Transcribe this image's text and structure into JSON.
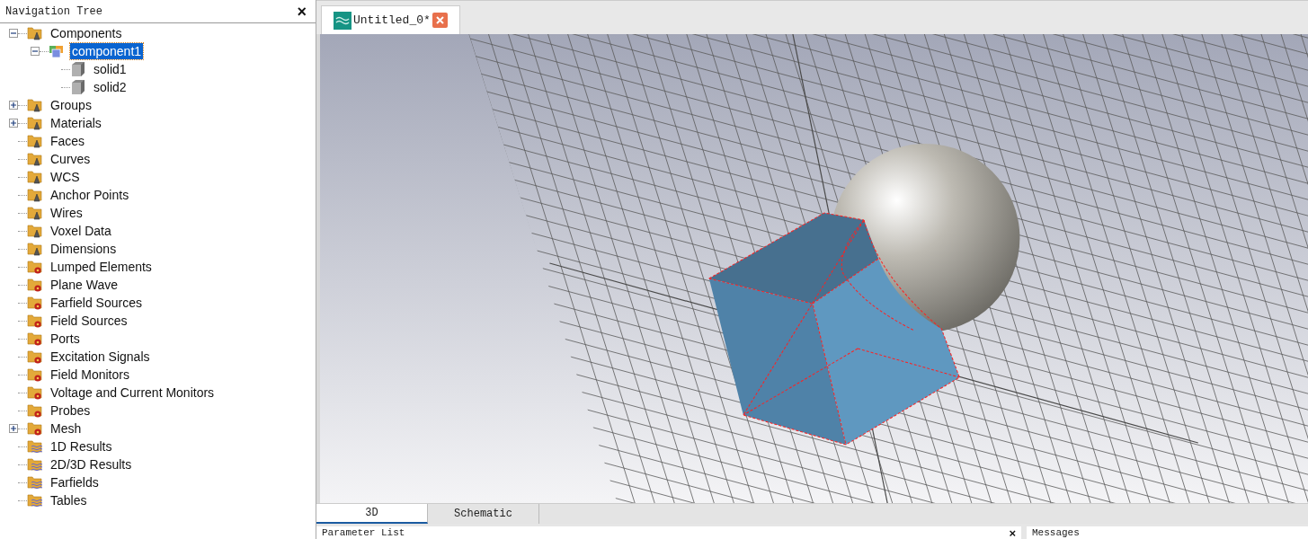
{
  "navigation_tree": {
    "title": "Navigation Tree",
    "close": "×",
    "items": [
      {
        "label": "Components",
        "kind": "cone",
        "expanded": true,
        "selected": false,
        "children": [
          {
            "label": "component1",
            "kind": "component",
            "expanded": true,
            "selected": true,
            "children": [
              {
                "label": "solid1",
                "kind": "solid",
                "selected": false
              },
              {
                "label": "solid2",
                "kind": "solid",
                "selected": false
              }
            ]
          }
        ]
      },
      {
        "label": "Groups",
        "kind": "cone",
        "expanded": false,
        "selected": false
      },
      {
        "label": "Materials",
        "kind": "cone",
        "expanded": false,
        "selected": false
      },
      {
        "label": "Faces",
        "kind": "cone",
        "selected": false
      },
      {
        "label": "Curves",
        "kind": "cone",
        "selected": false
      },
      {
        "label": "WCS",
        "kind": "cone",
        "selected": false
      },
      {
        "label": "Anchor Points",
        "kind": "cone",
        "selected": false
      },
      {
        "label": "Wires",
        "kind": "cone",
        "selected": false
      },
      {
        "label": "Voxel Data",
        "kind": "cone",
        "selected": false
      },
      {
        "label": "Dimensions",
        "kind": "cone",
        "selected": false
      },
      {
        "label": "Lumped Elements",
        "kind": "gear",
        "selected": false
      },
      {
        "label": "Plane Wave",
        "kind": "gear",
        "selected": false
      },
      {
        "label": "Farfield Sources",
        "kind": "gear",
        "selected": false
      },
      {
        "label": "Field Sources",
        "kind": "gear",
        "selected": false
      },
      {
        "label": "Ports",
        "kind": "gear",
        "selected": false
      },
      {
        "label": "Excitation Signals",
        "kind": "gear",
        "selected": false
      },
      {
        "label": "Field Monitors",
        "kind": "gear",
        "selected": false
      },
      {
        "label": "Voltage and Current Monitors",
        "kind": "gear",
        "selected": false
      },
      {
        "label": "Probes",
        "kind": "gear",
        "selected": false
      },
      {
        "label": "Mesh",
        "kind": "gear",
        "expanded": false,
        "selected": false
      },
      {
        "label": "1D Results",
        "kind": "wave",
        "selected": false
      },
      {
        "label": "2D/3D Results",
        "kind": "wave",
        "selected": false
      },
      {
        "label": "Farfields",
        "kind": "wave",
        "selected": false
      },
      {
        "label": "Tables",
        "kind": "wave",
        "selected": false
      }
    ]
  },
  "document_tabs": [
    {
      "label": "Untitled_0*",
      "selected": true
    }
  ],
  "view_tabs": [
    {
      "label": "3D",
      "selected": true
    },
    {
      "label": "Schematic",
      "selected": false
    }
  ],
  "bottom_panels": [
    {
      "title": "Parameter List",
      "close": "×"
    },
    {
      "title": "Messages"
    }
  ]
}
